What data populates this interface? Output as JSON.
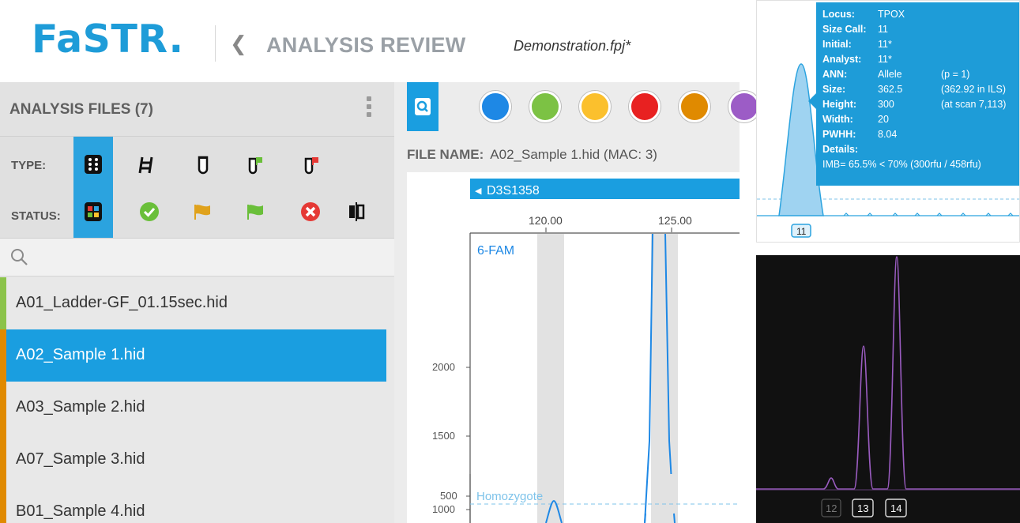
{
  "header": {
    "logo": "FaSTR.",
    "back_icon": "chevron-left-icon",
    "title": "ANALYSIS REVIEW",
    "project_file": "Demonstration.fpj*"
  },
  "left_panel": {
    "title": "ANALYSIS FILES (7)",
    "menu_icon": "kebab-menu-icon",
    "type_label": "TYPE:",
    "status_label": "STATUS:",
    "type_icons": [
      "plate-grid-icon",
      "ladder-icon",
      "tube-icon",
      "positive-control-tube-icon",
      "negative-control-tube-icon"
    ],
    "status_icons": [
      "all-status-icon",
      "check-circle-icon",
      "orange-flag-icon",
      "green-flag-icon",
      "error-circle-icon",
      "compare-icon"
    ],
    "search_icon": "search-icon",
    "files": [
      {
        "name": "A01_Ladder-GF_01.15sec.hid",
        "color": "#8bc34a",
        "selected": false
      },
      {
        "name": "A02_Sample 1.hid",
        "color": "#e08a00",
        "selected": true
      },
      {
        "name": "A03_Sample 2.hid",
        "color": "#e08a00",
        "selected": false
      },
      {
        "name": "A07_Sample 3.hid",
        "color": "#e08a00",
        "selected": false
      },
      {
        "name": "B01_Sample 4.hid",
        "color": "#e08a00",
        "selected": false
      }
    ]
  },
  "plot_panel": {
    "zoom_icon": "zoom-search-icon",
    "dye_colors": [
      "#1e88e5",
      "#7cc244",
      "#fbc02d",
      "#e82121",
      "#e08a00",
      "#9c5cc6"
    ],
    "file_name_label": "FILE NAME:",
    "file_name_value": "A02_Sample 1.hid (MAC: 3)",
    "marker": "D3S1358",
    "dye_label": "6-FAM",
    "threshold_label": "Homozygote",
    "x_ticks": [
      "120.00",
      "125.00"
    ],
    "y_ticks": [
      "2000",
      "1500",
      "1000",
      "500"
    ]
  },
  "tooltip": {
    "rows": [
      {
        "k": "Locus:",
        "v": "TPOX",
        "x": ""
      },
      {
        "k": "Size Call:",
        "v": "11",
        "x": ""
      },
      {
        "k": "Initial:",
        "v": "11*",
        "x": ""
      },
      {
        "k": "Analyst:",
        "v": "11*",
        "x": ""
      },
      {
        "k": "ANN:",
        "v": "Allele",
        "x": "(p = 1)"
      },
      {
        "k": "Size:",
        "v": "362.5",
        "x": "(362.92 in ILS)"
      },
      {
        "k": "Height:",
        "v": "300",
        "x": "(at scan 7,113)"
      },
      {
        "k": "Width:",
        "v": "20",
        "x": ""
      },
      {
        "k": "PWHH:",
        "v": "8.04",
        "x": ""
      },
      {
        "k": "Details:",
        "v": "",
        "x": ""
      }
    ],
    "imbalance": "IMB= 65.5% < 70% (300rfu / 458rfu)",
    "allele_label": "11"
  },
  "dark_panel": {
    "allele_labels": [
      "12",
      "13",
      "14"
    ]
  }
}
